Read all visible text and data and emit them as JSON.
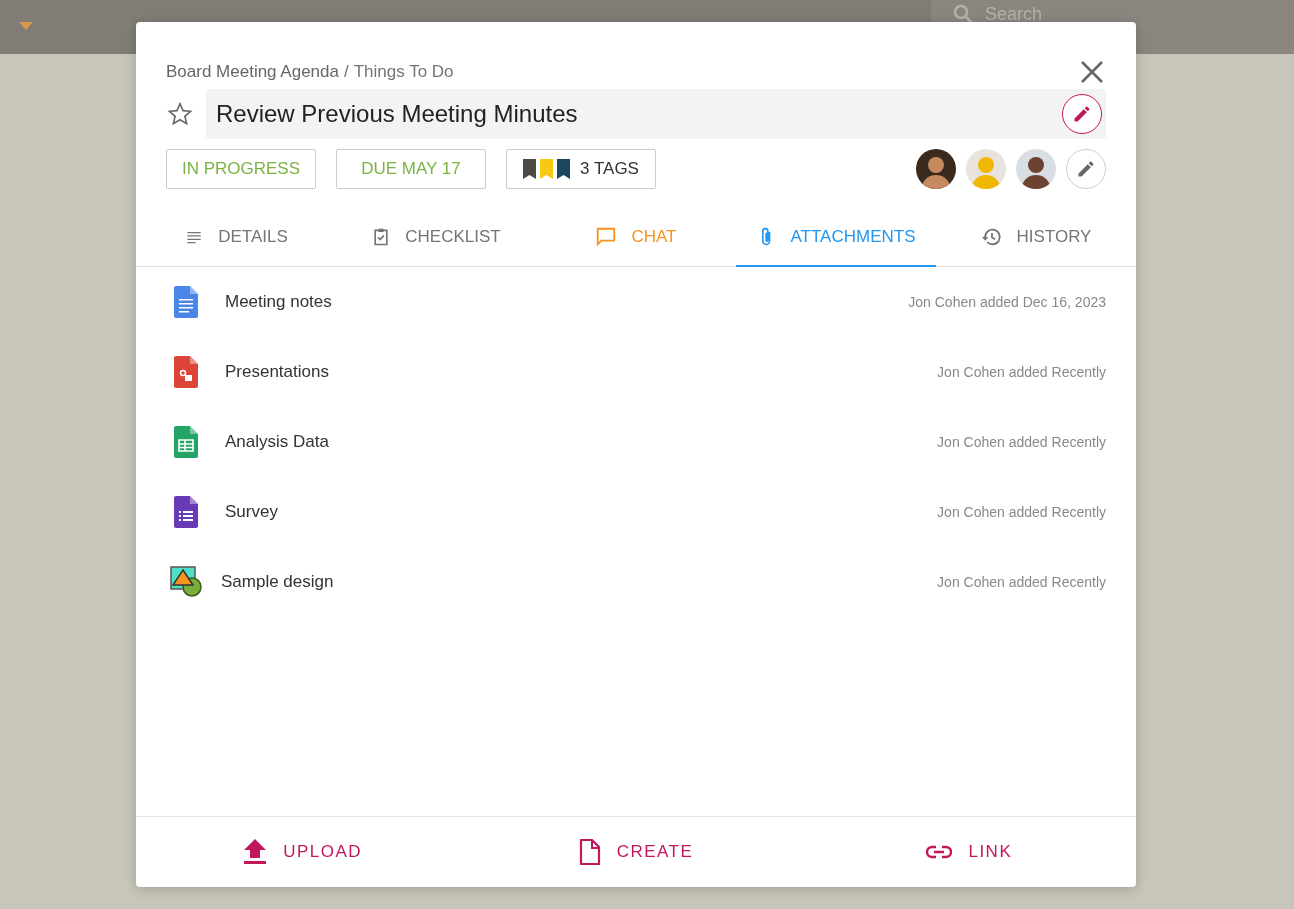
{
  "top_bar": {
    "search": {
      "placeholder": "Search"
    }
  },
  "dialog": {
    "breadcrumb": {
      "board": "Board Meeting Agenda",
      "separator": "/",
      "list": "Things To Do"
    },
    "starred": false,
    "title": "Review Previous Meeting Minutes",
    "status": "IN PROGRESS",
    "due": "DUE MAY 17",
    "tags": {
      "label": "3 TAGS",
      "items": [
        {
          "color": "#4e4a45"
        },
        {
          "color": "#f6c915"
        },
        {
          "color": "#1c465c"
        }
      ]
    },
    "members": [
      {
        "kind": "photo"
      },
      {
        "kind": "photo"
      },
      {
        "kind": "photo"
      }
    ],
    "tabs": [
      {
        "kind": "details",
        "label": "DETAILS",
        "selected": false,
        "highlighted": false
      },
      {
        "kind": "checklist",
        "label": "CHECKLIST",
        "selected": false,
        "highlighted": false
      },
      {
        "kind": "chat",
        "label": "CHAT",
        "selected": false,
        "highlighted": true
      },
      {
        "kind": "attachments",
        "label": "ATTACHMENTS",
        "selected": true,
        "highlighted": false
      },
      {
        "kind": "history",
        "label": "HISTORY",
        "selected": false,
        "highlighted": false
      }
    ],
    "attachments": [
      {
        "kind": "doc",
        "name": "Meeting notes",
        "added": "Jon Cohen added Dec 16, 2023"
      },
      {
        "kind": "slides",
        "name": "Presentations",
        "added": "Jon Cohen added Recently"
      },
      {
        "kind": "sheet",
        "name": "Analysis Data",
        "added": "Jon Cohen added Recently"
      },
      {
        "kind": "form",
        "name": "Survey",
        "added": "Jon Cohen added Recently"
      },
      {
        "kind": "drawing",
        "name": "Sample design",
        "added": "Jon Cohen added Recently"
      }
    ],
    "actions": [
      {
        "kind": "upload",
        "label": "UPLOAD"
      },
      {
        "kind": "create",
        "label": "CREATE"
      },
      {
        "kind": "link",
        "label": "LINK"
      }
    ]
  }
}
